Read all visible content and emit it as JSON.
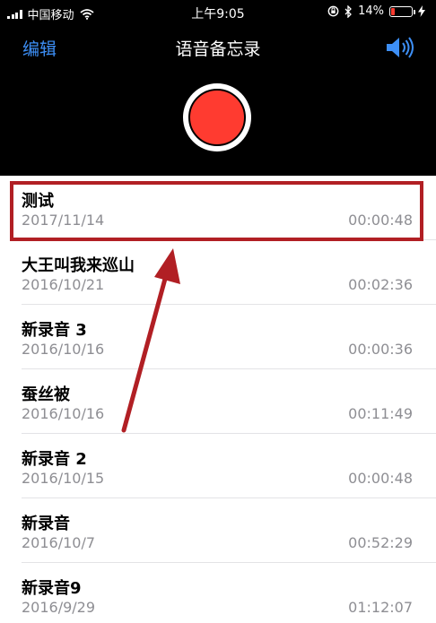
{
  "status": {
    "carrier": "中国移动",
    "time": "上午9:05",
    "battery": "14%"
  },
  "nav": {
    "edit": "编辑",
    "title": "语音备忘录"
  },
  "recordings": [
    {
      "name": "测试",
      "date": "2017/11/14",
      "duration": "00:00:48"
    },
    {
      "name": "大王叫我来巡山",
      "date": "2016/10/21",
      "duration": "00:02:36"
    },
    {
      "name": "新录音 3",
      "date": "2016/10/16",
      "duration": "00:00:36"
    },
    {
      "name": "蚕丝被",
      "date": "2016/10/16",
      "duration": "00:11:49"
    },
    {
      "name": "新录音 2",
      "date": "2016/10/15",
      "duration": "00:00:48"
    },
    {
      "name": "新录音",
      "date": "2016/10/7",
      "duration": "00:52:29"
    },
    {
      "name": "新录音9",
      "date": "2016/9/29",
      "duration": "01:12:07"
    }
  ],
  "colors": {
    "accent": "#3d8ff6",
    "record": "#ff3b30",
    "annotation": "#b11f24"
  },
  "icons": [
    "signal-icon",
    "wifi-icon",
    "orientation-lock-icon",
    "bluetooth-icon",
    "battery-icon",
    "charging-icon",
    "speaker-icon"
  ]
}
